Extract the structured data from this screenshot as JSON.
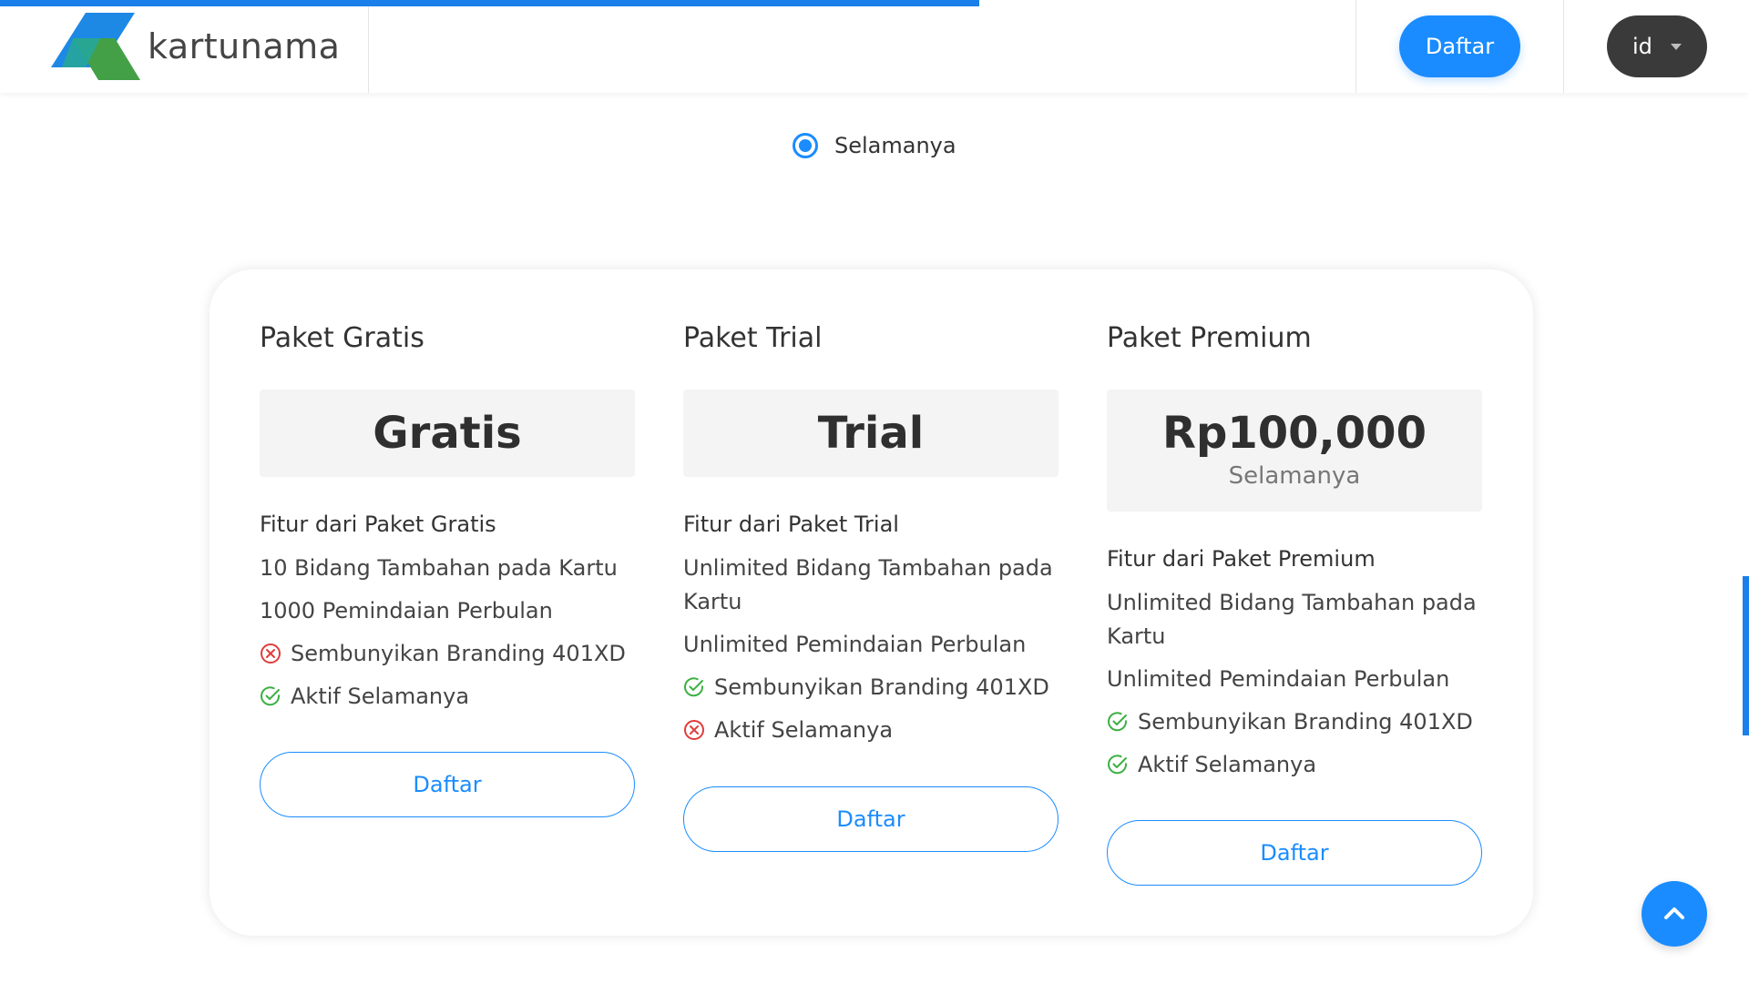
{
  "header": {
    "brand_name": "kartunama",
    "register_label": "Daftar",
    "language": "id",
    "progress_fraction": 0.56
  },
  "period_option": {
    "label": "Selamanya",
    "selected": true
  },
  "plans": [
    {
      "title": "Paket Gratis",
      "price": "Gratis",
      "period": "",
      "features_title": "Fitur dari Paket Gratis",
      "features": [
        {
          "text": "10 Bidang Tambahan pada Kartu",
          "icon": "none"
        },
        {
          "text": "1000 Pemindaian Perbulan",
          "icon": "none"
        },
        {
          "text": "Sembunyikan Branding 401XD",
          "icon": "x-circle-icon"
        },
        {
          "text": "Aktif Selamanya",
          "icon": "check-circle-icon"
        }
      ],
      "button_label": "Daftar"
    },
    {
      "title": "Paket Trial",
      "price": "Trial",
      "period": "",
      "features_title": "Fitur dari Paket Trial",
      "features": [
        {
          "text": "Unlimited Bidang Tambahan pada Kartu",
          "icon": "none"
        },
        {
          "text": "Unlimited Pemindaian Perbulan",
          "icon": "none"
        },
        {
          "text": "Sembunyikan Branding 401XD",
          "icon": "check-circle-icon"
        },
        {
          "text": "Aktif Selamanya",
          "icon": "x-circle-icon"
        }
      ],
      "button_label": "Daftar"
    },
    {
      "title": "Paket Premium",
      "price": "Rp100,000",
      "period": "Selamanya",
      "features_title": "Fitur dari Paket Premium",
      "features": [
        {
          "text": "Unlimited Bidang Tambahan pada Kartu",
          "icon": "none"
        },
        {
          "text": "Unlimited Pemindaian Perbulan",
          "icon": "none"
        },
        {
          "text": "Sembunyikan Branding 401XD",
          "icon": "check-circle-icon"
        },
        {
          "text": "Aktif Selamanya",
          "icon": "check-circle-icon"
        }
      ],
      "button_label": "Daftar"
    }
  ],
  "colors": {
    "accent": "#1a8cff",
    "check": "#3cb043",
    "cross": "#e03c3c",
    "lang_bg": "#3a3a3a"
  },
  "icons": {
    "scroll_top": "chevron-up-icon",
    "language_caret": "caret-down-icon"
  }
}
